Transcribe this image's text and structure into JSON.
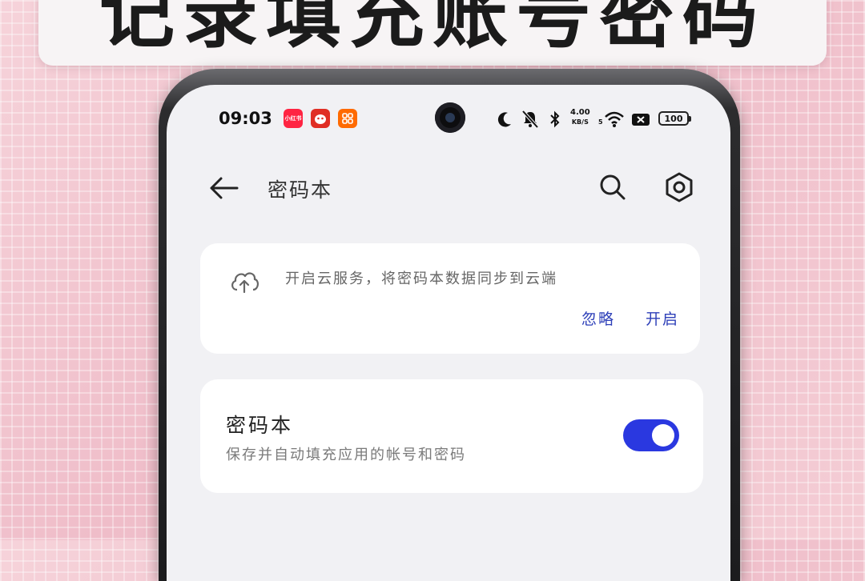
{
  "banner": {
    "title": "记录填充账号密码"
  },
  "status_bar": {
    "time": "09:03",
    "apps": [
      {
        "name": "小红书",
        "color": "#ff2442"
      },
      {
        "name": "拼多多",
        "color": "#e02e24"
      },
      {
        "name": "美团",
        "color": "#ff6a00"
      }
    ],
    "speed_value": "4.00",
    "speed_unit": "KB/S",
    "network": "5",
    "battery": "100"
  },
  "header": {
    "title": "密码本"
  },
  "cloud_prompt": {
    "message": "开启云服务，将密码本数据同步到云端",
    "ignore_label": "忽略",
    "enable_label": "开启"
  },
  "password_book": {
    "title": "密码本",
    "description": "保存并自动填充应用的帐号和密码",
    "enabled": true,
    "accent_color": "#2a38e0"
  }
}
